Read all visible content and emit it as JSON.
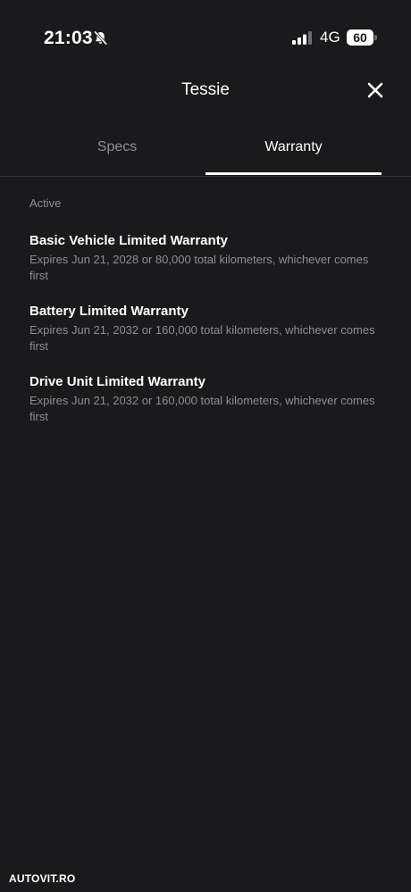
{
  "status_bar": {
    "time": "21:03",
    "network": "4G",
    "battery": "60",
    "icons": [
      "bell-slash-icon",
      "signal-bars-icon",
      "battery-icon"
    ]
  },
  "header": {
    "title": "Tessie",
    "close_icon": "close-icon"
  },
  "tabs": [
    {
      "label": "Specs",
      "active": false
    },
    {
      "label": "Warranty",
      "active": true
    }
  ],
  "section": {
    "label": "Active",
    "items": [
      {
        "title": "Basic Vehicle Limited Warranty",
        "description": "Expires Jun 21, 2028 or 80,000 total kilometers, whichever comes first"
      },
      {
        "title": "Battery Limited Warranty",
        "description": "Expires Jun 21, 2032 or 160,000 total kilometers, whichever comes first"
      },
      {
        "title": "Drive Unit Limited Warranty",
        "description": "Expires Jun 21, 2032 or 160,000 total kilometers, whichever comes first"
      }
    ]
  },
  "watermark": "AUTOVIT.RO",
  "colors": {
    "background": "#1a1a1c",
    "text_primary": "#ffffff",
    "text_secondary": "#8e8e93",
    "divider": "#38383b"
  }
}
